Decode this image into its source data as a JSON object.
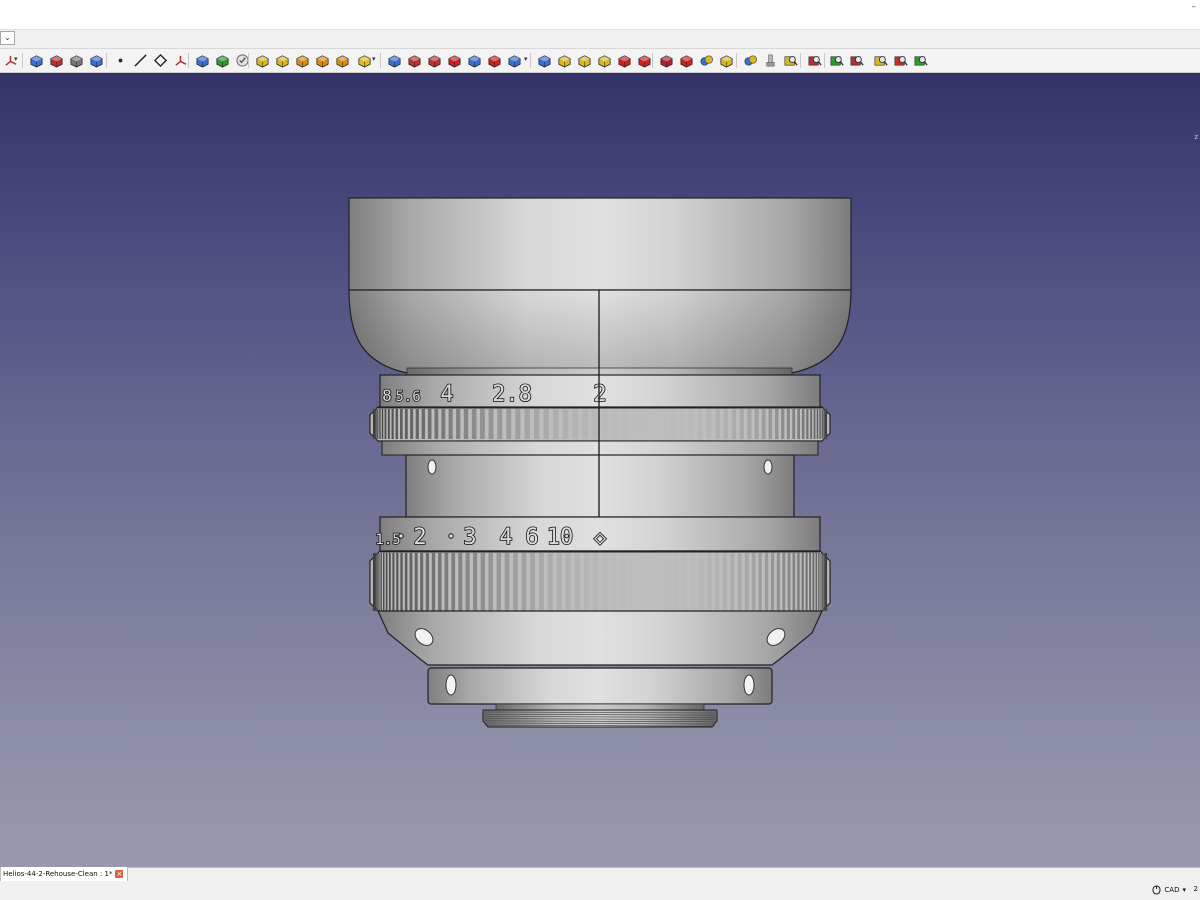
{
  "window": {
    "corner_mark": "–"
  },
  "combo": {
    "glyph": "⌄"
  },
  "toolbar": {
    "items": [
      {
        "icon": "axis-cross-icon",
        "color": "#b03030"
      },
      {
        "icon": "part-cube-icon",
        "color": "#3a6fd8"
      },
      {
        "icon": "part-export-icon",
        "color": "#c03030"
      },
      {
        "icon": "import-icon",
        "color": "#777777"
      },
      {
        "icon": "shape-builder-icon",
        "color": "#3a6fd8"
      },
      {
        "icon": "point-icon",
        "color": "#222222"
      },
      {
        "icon": "line-icon",
        "color": "#222222"
      },
      {
        "icon": "vertex-icon",
        "color": "#222222"
      },
      {
        "icon": "datum-axes-icon",
        "color": "#b03030"
      },
      {
        "icon": "box-primitive-icon",
        "color": "#3a6fd8"
      },
      {
        "icon": "shape-from-mesh-icon",
        "color": "#2a9a2a"
      },
      {
        "icon": "check-geometry-icon",
        "color": "#888888"
      },
      {
        "icon": "pad-icon",
        "color": "#d8b820"
      },
      {
        "icon": "pocket-icon",
        "color": "#d8b820"
      },
      {
        "icon": "revolution-icon",
        "color": "#e08a10"
      },
      {
        "icon": "groove-icon",
        "color": "#e08a10"
      },
      {
        "icon": "additive-loft-icon",
        "color": "#e08a10"
      },
      {
        "icon": "additive-pipe-icon",
        "color": "#e0c020"
      },
      {
        "icon": "pocket-blue-icon",
        "color": "#3a6fd8"
      },
      {
        "icon": "hole-icon",
        "color": "#c03030"
      },
      {
        "icon": "subtractive-revolve-icon",
        "color": "#c03030"
      },
      {
        "icon": "subtractive-loft-icon",
        "color": "#d02020"
      },
      {
        "icon": "subtractive-pipe-icon",
        "color": "#3a6fd8"
      },
      {
        "icon": "subtractive-helix-icon",
        "color": "#d02020"
      },
      {
        "icon": "mirrored-icon",
        "color": "#3a6fd8"
      },
      {
        "icon": "linear-pattern-icon",
        "color": "#3a6fd8"
      },
      {
        "icon": "polar-pattern-icon",
        "color": "#d8b820"
      },
      {
        "icon": "multi-transform-icon",
        "color": "#d8b820"
      },
      {
        "icon": "scaled-icon",
        "color": "#d8b820"
      },
      {
        "icon": "fillet-icon",
        "color": "#d02020"
      },
      {
        "icon": "chamfer-icon",
        "color": "#d02020"
      },
      {
        "icon": "draft-icon",
        "color": "#b02030"
      },
      {
        "icon": "thickness-icon",
        "color": "#d02020"
      },
      {
        "icon": "boolean-icon",
        "color": "#3a6fd8"
      },
      {
        "icon": "sprocket-icon",
        "color": "#d8b820"
      },
      {
        "icon": "involute-gear-icon",
        "color": "#3a6fd8"
      },
      {
        "icon": "shaft-wizard-icon",
        "color": "#999999"
      },
      {
        "icon": "measure-icon",
        "color": "#d8b820"
      },
      {
        "icon": "measure-clear-icon",
        "color": "#b03030"
      },
      {
        "icon": "measure-toggle-icon",
        "color": "#2a9a2a"
      },
      {
        "icon": "measure-linear-icon",
        "color": "#b03030"
      },
      {
        "icon": "measure-angular-icon",
        "color": "#d8b820"
      },
      {
        "icon": "measure-refresh-icon",
        "color": "#c03030"
      },
      {
        "icon": "measure-all-icon",
        "color": "#2a9a2a"
      }
    ]
  },
  "viewport": {
    "background_top": "#33336a",
    "background_bottom": "#9899ae",
    "axis_hint": "z",
    "lens": {
      "aperture_scale": [
        "5.6",
        "4",
        "2.8",
        "2"
      ],
      "aperture_partial": "8",
      "focus_scale": [
        "2",
        "3",
        "4",
        "6",
        "10"
      ],
      "focus_partial": "1.5",
      "infinity_mark": "◇",
      "body_color": "#c4c4c4"
    }
  },
  "document_tab": {
    "label": "Helios-44-2-Rehouse-Clean : 1*",
    "close_glyph": "×"
  },
  "statusbar": {
    "nav_style": "CAD",
    "nav_arrow": "▾",
    "right_text": "2"
  }
}
